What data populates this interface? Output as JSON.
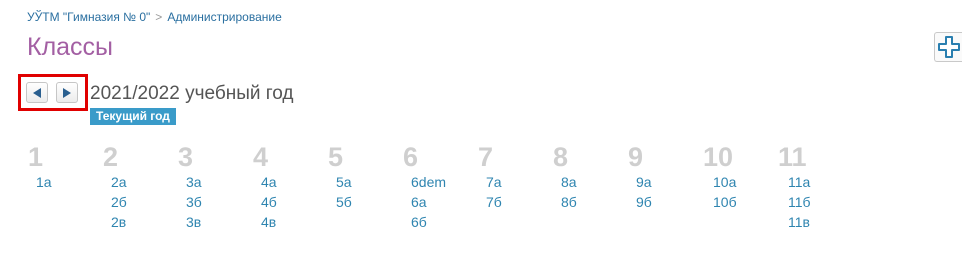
{
  "breadcrumb": {
    "school": "УЎТМ \"Гимназия № 0\"",
    "separator": ">",
    "section": "Администрирование"
  },
  "page_title": "Классы",
  "toolbar": {
    "add_icon": "plus-icon"
  },
  "year": {
    "label": "2021/2022 учебный год",
    "badge": "Текущий год",
    "prev_icon": "arrow-left-icon",
    "next_icon": "arrow-right-icon"
  },
  "colors": {
    "accent": "#a35fa3",
    "link": "#2f85b0",
    "badge": "#3a9bc9",
    "grade_number": "#cfcfcf",
    "highlight": "#e00000"
  },
  "grades": [
    {
      "number": "1",
      "classes": [
        "1а"
      ]
    },
    {
      "number": "2",
      "classes": [
        "2а",
        "2б",
        "2в"
      ]
    },
    {
      "number": "3",
      "classes": [
        "3а",
        "3б",
        "3в"
      ]
    },
    {
      "number": "4",
      "classes": [
        "4а",
        "4б",
        "4в"
      ]
    },
    {
      "number": "5",
      "classes": [
        "5а",
        "5б"
      ]
    },
    {
      "number": "6",
      "classes": [
        "6dem",
        "6а",
        "6б"
      ]
    },
    {
      "number": "7",
      "classes": [
        "7а",
        "7б"
      ]
    },
    {
      "number": "8",
      "classes": [
        "8а",
        "8б"
      ]
    },
    {
      "number": "9",
      "classes": [
        "9а",
        "9б"
      ]
    },
    {
      "number": "10",
      "classes": [
        "10а",
        "10б"
      ]
    },
    {
      "number": "11",
      "classes": [
        "11а",
        "11б",
        "11в"
      ]
    }
  ]
}
